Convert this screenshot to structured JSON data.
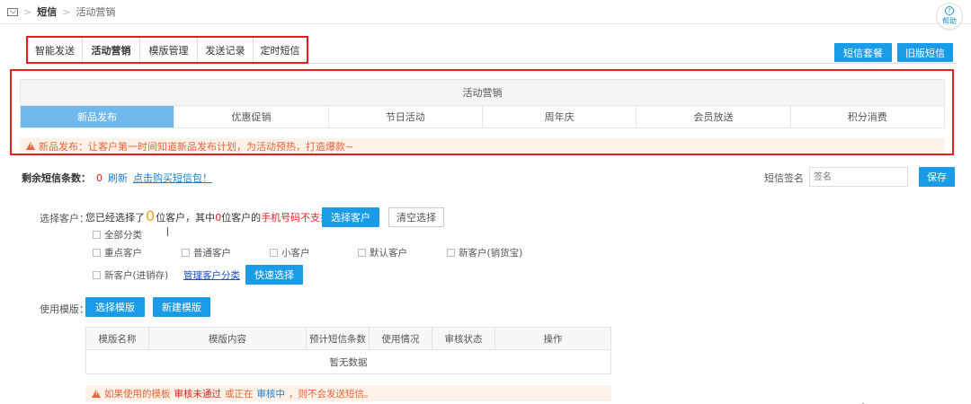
{
  "breadcrumb": {
    "root": "短信",
    "current": "活动营销",
    "separator": ">"
  },
  "help": {
    "label": "帮助"
  },
  "main_tabs": [
    {
      "label": "智能发送"
    },
    {
      "label": "活动营销"
    },
    {
      "label": "模版管理"
    },
    {
      "label": "发送记录"
    },
    {
      "label": "定时短信"
    }
  ],
  "header_buttons": {
    "package": "短信套餐",
    "old_sms": "旧版短信"
  },
  "activity": {
    "title": "活动营销",
    "tabs": [
      {
        "label": "新品发布",
        "active": true
      },
      {
        "label": "优惠促销"
      },
      {
        "label": "节日活动"
      },
      {
        "label": "周年庆"
      },
      {
        "label": "会员放送"
      },
      {
        "label": "积分消费"
      }
    ],
    "tip": "新品发布：让客户第一时间知道新品发布计划，为活动预热，打造爆款~"
  },
  "remaining": {
    "label": "剩余短信条数：",
    "count": "0",
    "refresh": "刷新",
    "buy": "点击购买短信包！"
  },
  "signature": {
    "label": "短信签名",
    "placeholder": "签名",
    "save": "保存"
  },
  "customer": {
    "label": "选择客户：",
    "text_prefix": "您已经选择了",
    "selected_count": "0",
    "text_mid": "位客户，其中",
    "unsupported_count": "0",
    "text_mid2": "位客户的",
    "unsupported_text": "手机号码不支持",
    "select_button": "选择客户",
    "clear_button": "清空选择",
    "categories": [
      "全部分类",
      "重点客户",
      "普通客户",
      "小客户",
      "默认客户",
      "新客户(销货宝)",
      "新客户(进销存)"
    ],
    "manage_link": "管理客户分类",
    "quick_button": "快速选择"
  },
  "template": {
    "label": "使用模版：",
    "select_button": "选择模版",
    "new_button": "新建模版",
    "columns": [
      "模版名称",
      "模版内容",
      "预计短信条数",
      "使用情况",
      "审核状态",
      "操作"
    ],
    "empty": "暂无数据"
  },
  "bottom_tip": {
    "part1": "如果使用的模板",
    "part2": "审核未通过",
    "part3": "或正在",
    "part4": "审核中",
    "part5": "，则不会发送短信。"
  },
  "colors": {
    "primary": "#1a9be8",
    "active_tab": "#6fb9ef",
    "highlight_border": "#e02020",
    "warning": "#e8663a"
  }
}
